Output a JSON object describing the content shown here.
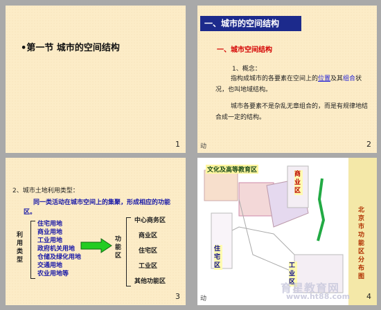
{
  "slides": [
    {
      "number": "1",
      "title": "第一节 城市的空间结构"
    },
    {
      "number": "2",
      "banner": "一、城市的空间结构",
      "heading": "一、城市空间结构",
      "point": "1、概念：",
      "text1a": "指构成城市的各要素在空间上的",
      "hl_pos": "位置",
      "text1b": "及其",
      "hl_combo": "组合",
      "text1c": "状况，也叫地域结构。",
      "text2": "城市各要素不是杂乱无章组合的，而是有规律地结合成一定的结构。",
      "rec": "动"
    },
    {
      "number": "3",
      "point": "2、城市土地利用类型：",
      "desc": "同一类活动在城市空间上的集聚，形成相应的功能区。",
      "left_label": "利用类型",
      "land_uses": [
        "住宅用地",
        "商业用地",
        "工业用地",
        "政府机关用地",
        "仓储及绿化用地",
        "交通用地",
        "农业用地等"
      ],
      "mid_label": "功能区",
      "zones": [
        "中心商务区",
        "商业区",
        "住宅区",
        "工业区",
        "其他功能区"
      ],
      "rec": "动"
    },
    {
      "number": "4",
      "map_title": "文化及高等教育区",
      "label_commerce": "商业区",
      "label_residential": "住宅区",
      "label_industry": "工业区",
      "vertical_text": "北京市功能区分布图",
      "watermark": "育星教育网",
      "watermark_url": "www.ht88.com",
      "rec": "动"
    }
  ]
}
